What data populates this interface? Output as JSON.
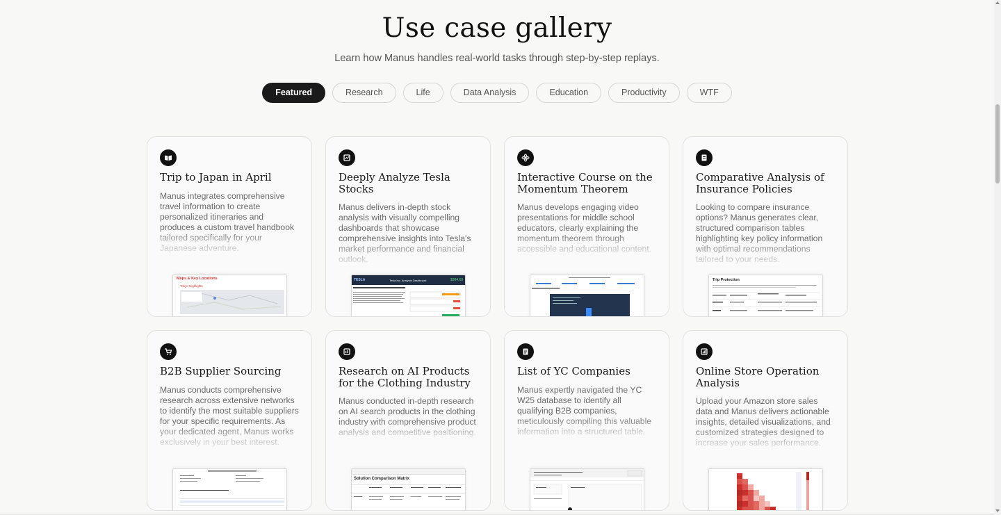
{
  "header": {
    "title": "Use case gallery",
    "subtitle": "Learn how Manus handles real-world tasks through step-by-step replays."
  },
  "tabs": [
    {
      "label": "Featured",
      "active": true
    },
    {
      "label": "Research",
      "active": false
    },
    {
      "label": "Life",
      "active": false
    },
    {
      "label": "Data Analysis",
      "active": false
    },
    {
      "label": "Education",
      "active": false
    },
    {
      "label": "Productivity",
      "active": false
    },
    {
      "label": "WTF",
      "active": false
    }
  ],
  "cards": [
    {
      "icon": "book-icon",
      "title": "Trip to Japan in April",
      "description": "Manus integrates comprehensive travel information to create personalized itineraries and produces a custom travel handbook tailored specifically for your Japanese adventure.",
      "thumb": {
        "heading": "Maps & Key Locations",
        "sub": "Tokyo Highlights"
      }
    },
    {
      "icon": "chart-icon",
      "title": "Deeply Analyze Tesla Stocks",
      "description": "Manus delivers in-depth stock analysis with visually compelling dashboards that showcase comprehensive insights into Tesla's market performance and financial outlook.",
      "thumb": {
        "brand": "TESLA",
        "heading": "Tesla Inc. Analysis Dashboard",
        "price": "$384.69"
      }
    },
    {
      "icon": "atom-icon",
      "title": "Interactive Course on the Momentum Theorem",
      "description": "Manus develops engaging video presentations for middle school educators, clearly explaining the momentum theorem through accessible and educational content.",
      "thumb": {}
    },
    {
      "icon": "document-icon",
      "title": "Comparative Analysis of Insurance Policies",
      "description": "Looking to compare insurance options? Manus generates clear, structured comparison tables highlighting key policy information with optimal recommendations tailored to your needs.",
      "thumb": {
        "heading": "Trip Protection"
      }
    },
    {
      "icon": "cart-icon",
      "title": "B2B Supplier Sourcing",
      "description": "Manus conducts comprehensive research across extensive networks to identify the most suitable suppliers for your specific requirements. As your dedicated agent, Manus works exclusively in your best interest.",
      "thumb": {}
    },
    {
      "icon": "report-icon",
      "title": "Research on AI Products for the Clothing Industry",
      "description": "Manus conducted in-depth research on AI search products in the clothing industry with comprehensive product analysis and competitive positioning.",
      "thumb": {
        "heading": "Solution Comparison Matrix"
      }
    },
    {
      "icon": "list-icon",
      "title": "List of YC Companies",
      "description": "Manus expertly navigated the YC W25 database to identify all qualifying B2B companies, meticulously compiling this valuable information into a structured table.",
      "thumb": {}
    },
    {
      "icon": "bar-chart-icon",
      "title": "Online Store Operation Analysis",
      "description": "Upload your Amazon store sales data and Manus delivers actionable insights, detailed visualizations, and customized strategies designed to increase your sales performance.",
      "thumb": {}
    }
  ]
}
